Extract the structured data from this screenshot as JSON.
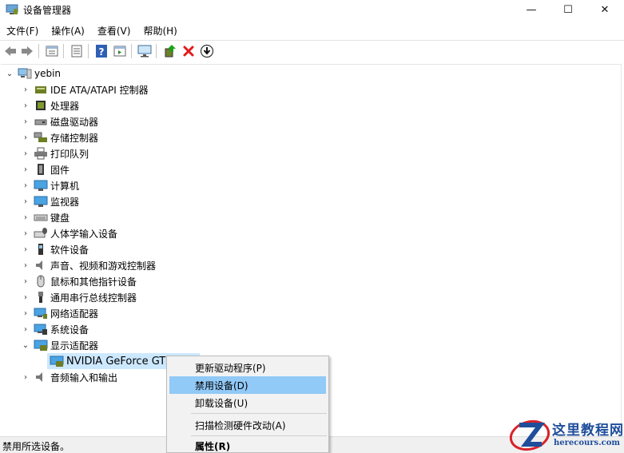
{
  "window": {
    "title": "设备管理器",
    "minimize_glyph": "—",
    "maximize_glyph": "☐",
    "close_glyph": "✕"
  },
  "menu": [
    "文件(F)",
    "操作(A)",
    "查看(V)",
    "帮助(H)"
  ],
  "toolbar": {
    "buttons": [
      "back-arrow-icon",
      "forward-arrow-icon",
      "properties-icon",
      "details-icon",
      "help-icon",
      "action-pane-icon",
      "monitor-scan-icon",
      "update-driver-icon",
      "uninstall-icon",
      "download-icon"
    ]
  },
  "tree": {
    "root": "yebin",
    "categories": [
      "IDE ATA/ATAPI 控制器",
      "处理器",
      "磁盘驱动器",
      "存储控制器",
      "打印队列",
      "固件",
      "计算机",
      "监视器",
      "键盘",
      "人体学输入设备",
      "软件设备",
      "声音、视频和游戏控制器",
      "鼠标和其他指针设备",
      "通用串行总线控制器",
      "网络适配器",
      "系统设备",
      "显示适配器"
    ],
    "expanded_child": "NVIDIA GeForce GTX",
    "after": "音频输入和输出"
  },
  "context_menu": {
    "items": [
      "更新驱动程序(P)",
      "禁用设备(D)",
      "卸载设备(U)",
      "扫描检测硬件改动(A)",
      "属性(R)"
    ],
    "highlighted_index": 1
  },
  "status": "禁用所选设备。",
  "watermark": {
    "cn": "这里教程网",
    "en": "herecours.com"
  },
  "colors": {
    "selection": "#cce8ff",
    "menu_highlight": "#91c9f7",
    "watermark_blue": "#1f4e9b",
    "watermark_red": "#d8232a",
    "delete_red": "#e21b1b"
  }
}
